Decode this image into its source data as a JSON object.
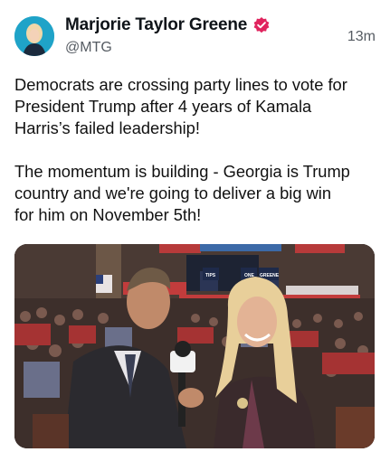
{
  "post": {
    "author_name": "Marjorie Taylor Greene",
    "handle": "@MTG",
    "timestamp": "13m",
    "body_lines": [
      "Democrats are crossing party lines to vote for",
      "President Trump after 4 years of Kamala",
      "Harris’s failed leadership!",
      "",
      "The momentum is building - Georgia is Trump",
      "country and we're going to deliver a big win",
      "for him on November 5th!"
    ],
    "media": {
      "signs": [
        "TIPS",
        "ONE",
        "GREENE"
      ]
    }
  },
  "colors": {
    "verified_badge": "#e0245e",
    "avatar_bg": "#1fa3c8",
    "handle_gray": "#555b62"
  }
}
